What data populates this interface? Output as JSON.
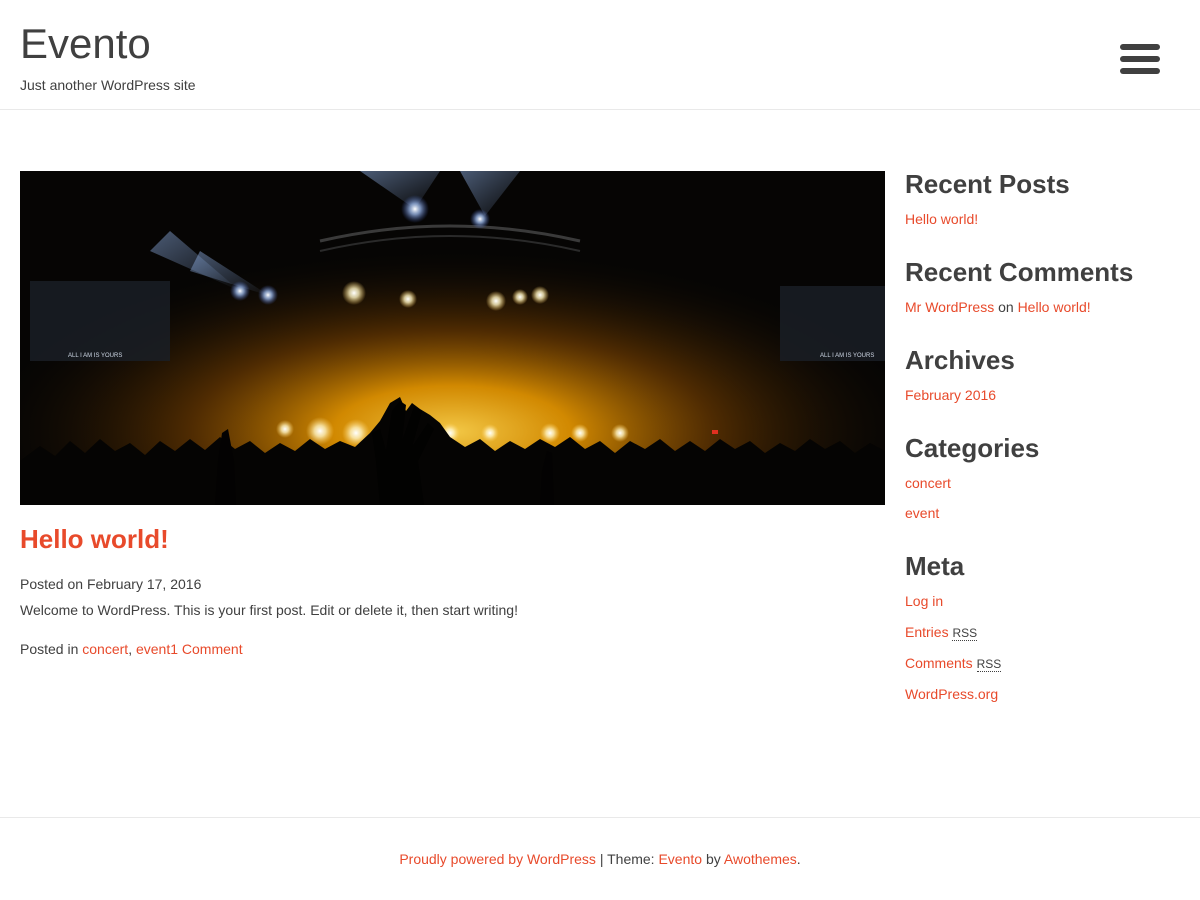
{
  "header": {
    "site_title": "Evento",
    "site_description": "Just another WordPress site",
    "menu_icon": "hamburger-menu-icon"
  },
  "post": {
    "image_alt": "Concert stage with lights and crowd",
    "stage_screen_text": "ALL I AM IS YOURS",
    "title": "Hello world!",
    "posted_on_label": "Posted on",
    "date": "February 17, 2016",
    "excerpt": "Welcome to WordPress. This is your first post. Edit or delete it, then start writing!",
    "posted_in_label": "Posted in",
    "category_1": "concert",
    "separator": ",",
    "category_2": "event",
    "comments_link": "1 Comment"
  },
  "sidebar": {
    "recent_posts": {
      "title": "Recent Posts",
      "items": [
        "Hello world!"
      ]
    },
    "recent_comments": {
      "title": "Recent Comments",
      "author": "Mr WordPress",
      "on": "on",
      "post": "Hello world!"
    },
    "archives": {
      "title": "Archives",
      "items": [
        "February 2016"
      ]
    },
    "categories": {
      "title": "Categories",
      "items": [
        "concert",
        "event"
      ]
    },
    "meta": {
      "title": "Meta",
      "login": "Log in",
      "entries": "Entries",
      "comments": "Comments",
      "rss": "RSS",
      "wordpress_org": "WordPress.org"
    }
  },
  "footer": {
    "powered": "Proudly powered by WordPress",
    "separator": "|",
    "theme_label": "Theme:",
    "theme_name": "Evento",
    "by": "by",
    "author": "Awothemes",
    "end": "."
  },
  "colors": {
    "accent": "#e84a2b",
    "text": "#404040",
    "border": "#e9e9e9",
    "stage_glow": "#ffb300"
  }
}
